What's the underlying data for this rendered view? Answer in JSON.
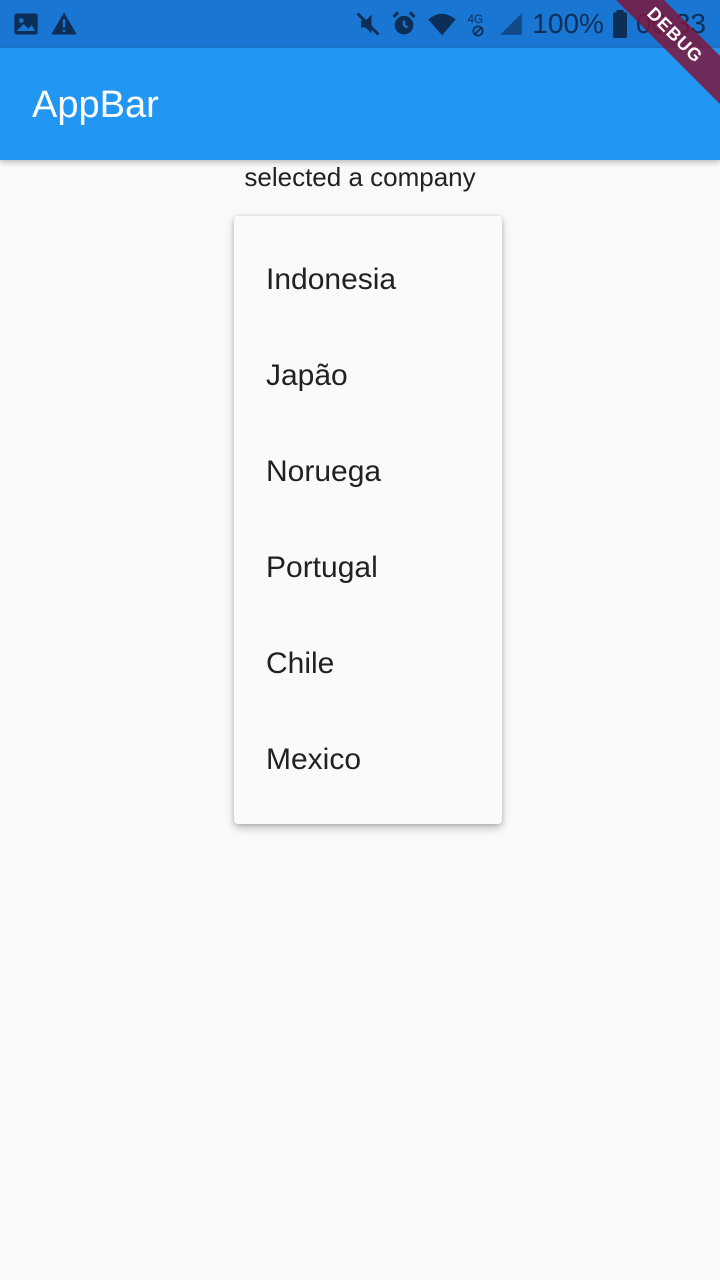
{
  "status_bar": {
    "left_icons": [
      "image-icon",
      "warning-icon"
    ],
    "right_icons": [
      "mute-icon",
      "alarm-icon",
      "wifi-icon",
      "network-4g-icon",
      "signal-icon",
      "battery-icon"
    ],
    "network_label": "4G",
    "battery_percent": "100%",
    "time": "00:33"
  },
  "app_bar": {
    "title": "AppBar"
  },
  "debug_banner": "DEBUG",
  "content": {
    "subtitle": "selected a company",
    "dropdown_items": [
      "Indonesia",
      "Japão",
      "Noruega",
      "Portugal",
      "Chile",
      "Mexico"
    ]
  },
  "colors": {
    "status_bar": "#1976d2",
    "app_bar": "#2196f3",
    "background": "#fafafa",
    "debug_ribbon": "#801538"
  }
}
